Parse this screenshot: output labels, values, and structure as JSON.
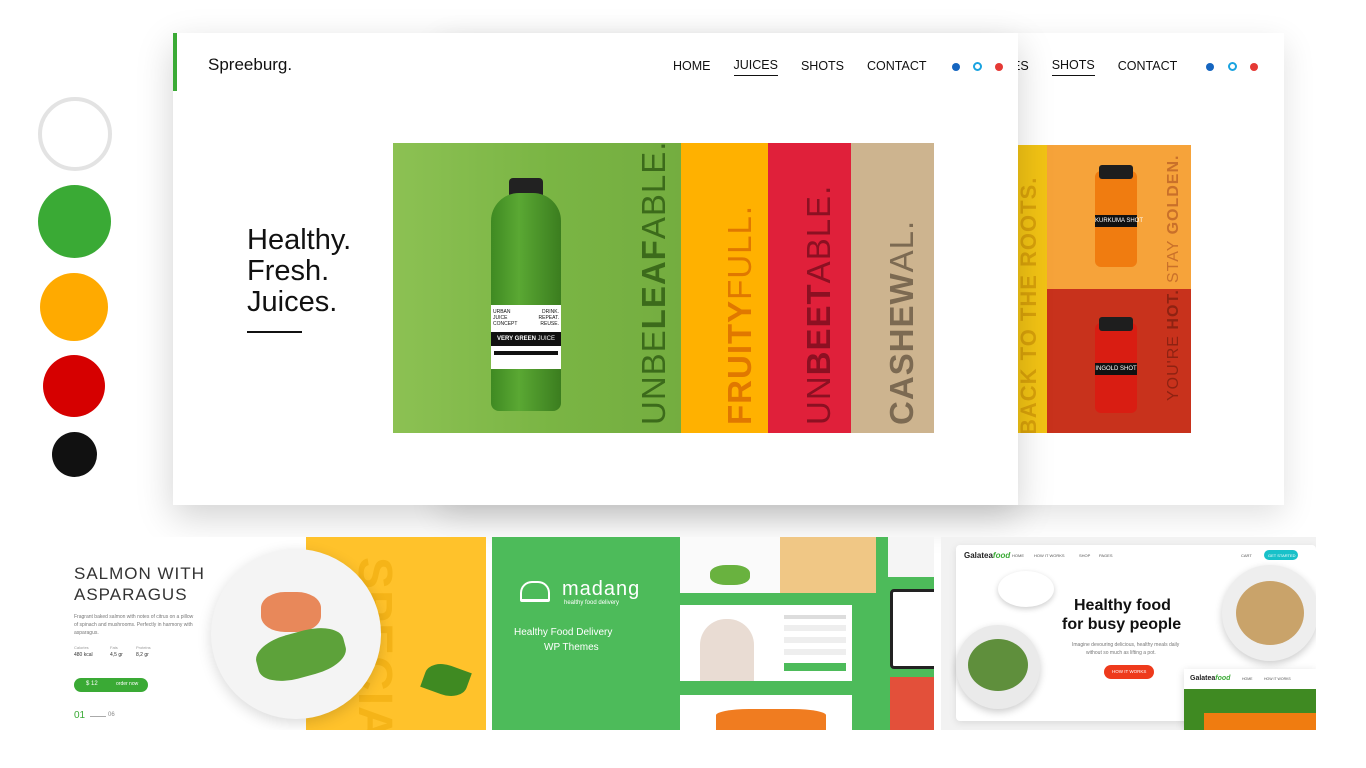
{
  "palette": [
    "#e6e6e6",
    "#3aaa35",
    "#ffaa00",
    "#d60000",
    "#111111"
  ],
  "front": {
    "brand": "Spreeburg.",
    "nav": [
      "HOME",
      "JUICES",
      "SHOTS",
      "CONTACT"
    ],
    "active": "JUICES",
    "hero_lines": [
      "Healthy.",
      "Fresh.",
      "Juices."
    ],
    "label_top_left": "URBAN JUICE CONCEPT",
    "label_top_right": "DRINK. REPEAT. REUSE.",
    "label_name_bold": "VERY GREEN",
    "label_name": "JUICE",
    "panels": [
      {
        "pre": "UNBE",
        "bold": "LEAF",
        "post": "ABLE."
      },
      {
        "pre": "",
        "bold": "FRUITY",
        "post": "FULL."
      },
      {
        "pre": "UN",
        "bold": "BEET",
        "post": "ABLE."
      },
      {
        "pre": "",
        "bold": "CASHEW",
        "post": "AL."
      }
    ]
  },
  "back": {
    "nav_partial": "ES",
    "nav": [
      "SHOTS",
      "CONTACT"
    ],
    "roots_text": "BACK TO THE ROOTS.",
    "golden": {
      "pre": "STAY ",
      "bold": "GOLDEN."
    },
    "hot": {
      "pre": "YOU'RE ",
      "bold": "HOT."
    },
    "jar1": "KURKUMA SHOT",
    "jar2": "INGOLD SHOT"
  },
  "thumb1": {
    "title_line1": "SALMON WITH",
    "title_line2": "ASPARAGUS",
    "desc1": "Fragrant baked salmon with notes of citrus on a pillow",
    "desc2": "of spinach and mushrooms. Perfectly in harmony with",
    "desc3": "asparagus.",
    "stats_labels": [
      "Calories",
      "Fats",
      "Proteins"
    ],
    "stats_values": [
      "480 kcal",
      "4,5 gr",
      "8,2 gr"
    ],
    "price": "$ 12",
    "order": "order now",
    "page_current": "01",
    "page_total": "06",
    "bg_word": "SPECIA"
  },
  "thumb2": {
    "logo": "madang",
    "sub": "healthy food delivery",
    "line1": "Healthy Food Delivery",
    "line2": "WP Themes"
  },
  "thumb3": {
    "logo": "Galatea",
    "logo_suffix": "food",
    "nav": [
      "HOME",
      "HOW IT WORKS",
      "SHOP",
      "PAGES"
    ],
    "cart": "CART",
    "cta_top": "GET STARTED",
    "headline1": "Healthy food",
    "headline2": "for busy people",
    "desc1": "Imagine devouring delicious, healthy meals daily",
    "desc2": "without so much as lifting a pot.",
    "button": "HOW IT WORKS"
  },
  "colors": {
    "green": "#3aaa35",
    "orange": "#ffaa00",
    "red": "#d60000",
    "blue": "#1565c0",
    "cyan": "#1aa3e0",
    "social_red": "#e53935"
  }
}
